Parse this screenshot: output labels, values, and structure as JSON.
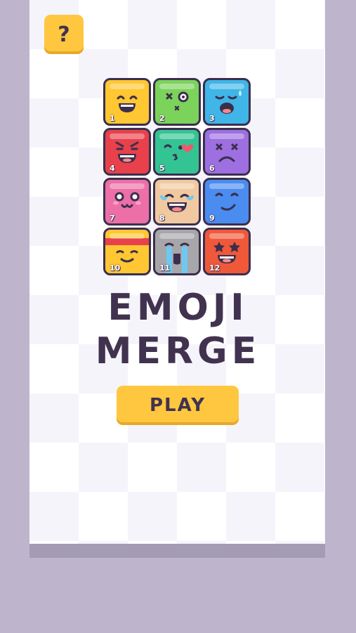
{
  "game": {
    "title_line1": "EMOJI",
    "title_line2": "MERGE",
    "play_label": "PLAY",
    "help_label": "?"
  },
  "tiles": [
    {
      "number": "1",
      "color": "#ffc731",
      "face": "grin-squint"
    },
    {
      "number": "2",
      "color": "#7cd35b",
      "face": "dizzy"
    },
    {
      "number": "3",
      "color": "#3fb5e8",
      "face": "sweat-crying"
    },
    {
      "number": "4",
      "color": "#e8414b",
      "face": "angry-laugh"
    },
    {
      "number": "5",
      "color": "#34c494",
      "face": "kissing-heart"
    },
    {
      "number": "6",
      "color": "#9d6fe0",
      "face": "dead-frown"
    },
    {
      "number": "7",
      "color": "#ec6fa7",
      "face": "cute-blush"
    },
    {
      "number": "8",
      "color": "#f1c9a0",
      "face": "tears-of-joy"
    },
    {
      "number": "9",
      "color": "#4a8cf0",
      "face": "smirk"
    },
    {
      "number": "10",
      "color": "#ffc731",
      "face": "headband-smile"
    },
    {
      "number": "11",
      "color": "#a7a7ab",
      "face": "sobbing"
    },
    {
      "number": "12",
      "color": "#f0583a",
      "face": "star-struck"
    }
  ],
  "colors": {
    "background": "#beb5cd",
    "board": "#f6f4fb",
    "accent": "#ffc73f",
    "text": "#41334f"
  }
}
